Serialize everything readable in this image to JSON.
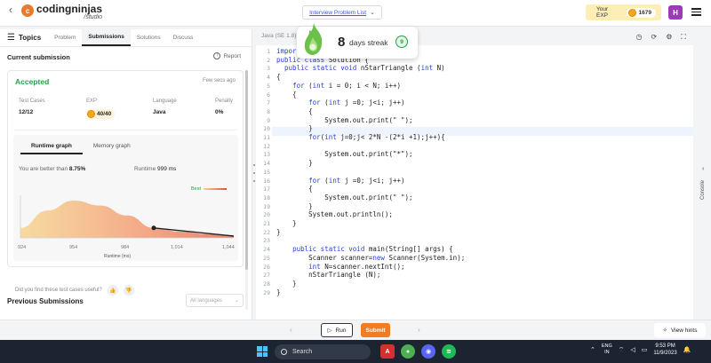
{
  "header": {
    "logo_main": "codingninjas",
    "logo_sub": "/studio",
    "problem_list": "Interview Problem List",
    "exp_label": "Your EXP",
    "exp_value": "1679",
    "avatar_letter": "H"
  },
  "left": {
    "topics": "Topics",
    "tabs": [
      "Problem",
      "Submissions",
      "Solutions",
      "Discuss"
    ],
    "current_submission": "Current submission",
    "report": "Report",
    "status": "Accepted",
    "time_ago": "Few secs ago",
    "stats": [
      {
        "label": "Test Cases",
        "value": "12/12"
      },
      {
        "label": "EXP",
        "value": "40/40"
      },
      {
        "label": "Language",
        "value": "Java"
      },
      {
        "label": "Penalty",
        "value": "0%"
      }
    ],
    "graph_tabs": [
      "Runtime graph",
      "Memory graph"
    ],
    "better_prefix": "You are better than",
    "better_value": "8.75%",
    "runtime_label": "Runtime",
    "runtime_value": "999 ms",
    "best_label": "Best",
    "x_ticks": [
      "924",
      "954",
      "984",
      "1,014",
      "1,044"
    ],
    "x_label": "Runtime (ms)",
    "feedback_question": "Did you find these test cases useful?",
    "previous_submissions": "Previous Submissions",
    "language_filter_placeholder": "All languages"
  },
  "editor": {
    "language_tab": "Java (SE 1.8)",
    "lines": [
      "import java.util.*;",
      "public class Solution {",
      "  public static void nStarTriangle (int N)",
      "{",
      "    for (int i = 0; i < N; i++)",
      "    {",
      "        for (int j =0; j<i; j++)",
      "        {",
      "            System.out.print(\" \");",
      "        }",
      "        for(int j=0;j< 2*N -(2*i +1);j++){",
      "",
      "            System.out.print(\"*\");",
      "        }",
      "",
      "        for (int j =0; j<i; j++)",
      "        {",
      "            System.out.print(\" \");",
      "        }",
      "        System.out.println();",
      "    }",
      "}",
      "",
      "    public static void main(String[] args) {",
      "        Scanner scanner=new Scanner(System.in);",
      "        int N=scanner.nextInt();",
      "        nStarTriangle (N);",
      "    }",
      "}"
    ]
  },
  "streak": {
    "count": "8",
    "label": "days streak",
    "badge": "9"
  },
  "console_label": "Console",
  "bottom": {
    "run": "Run",
    "submit": "Submit",
    "view_hints": "View hints"
  },
  "taskbar": {
    "search": "Search",
    "lang_line1": "ENG",
    "lang_line2": "IN",
    "time": "9:53 PM",
    "date": "11/9/2023"
  },
  "colors": {
    "accepted": "#24a148",
    "submit": "#f47c20",
    "keyword": "#2a3fd6",
    "exp_bg": "#fdeeb8"
  },
  "chart_data": {
    "type": "area",
    "x": [
      924,
      939,
      954,
      969,
      984,
      999,
      1014,
      1029,
      1044
    ],
    "values": [
      8,
      22,
      30,
      26,
      18,
      8,
      5,
      3,
      2
    ],
    "marker_x": 999,
    "xlim": [
      924,
      1044
    ],
    "xlabel": "Runtime (ms)",
    "x_ticks": [
      924,
      954,
      984,
      1014,
      1044
    ],
    "legend": "Best"
  }
}
